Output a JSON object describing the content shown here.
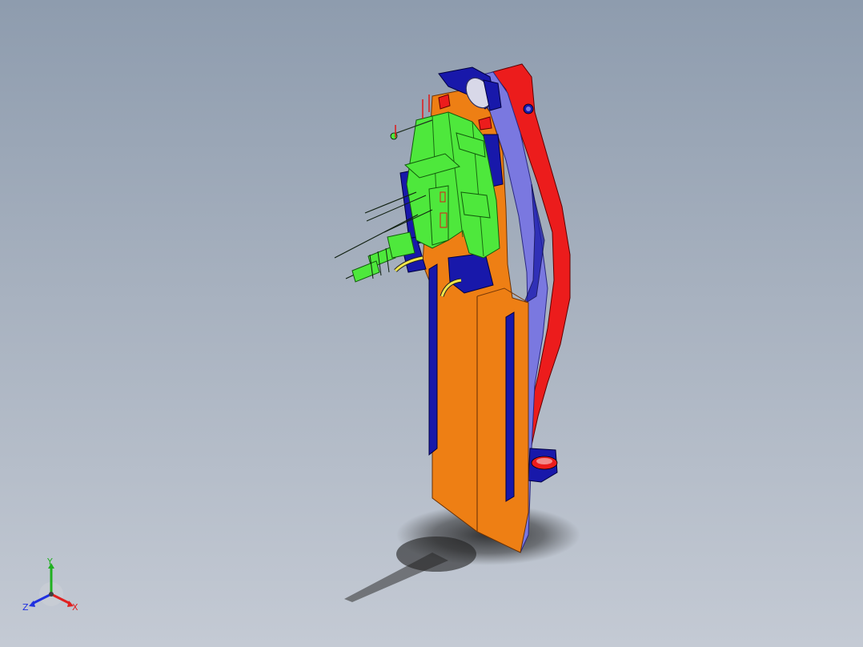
{
  "viewport": {
    "background_top": "#8e9cae",
    "background_bottom": "#c4cad4"
  },
  "model": {
    "colors": {
      "orange": "#ee7f14",
      "blue": "#1818aa",
      "lavender": "#7a78e0",
      "red": "#ec1c1c",
      "green": "#4ee83c",
      "yellow": "#f2e64a"
    }
  },
  "triad": {
    "x_label": "X",
    "y_label": "Y",
    "z_label": "Z",
    "x_color": "#e02020",
    "y_color": "#20b020",
    "z_color": "#2030e0"
  }
}
